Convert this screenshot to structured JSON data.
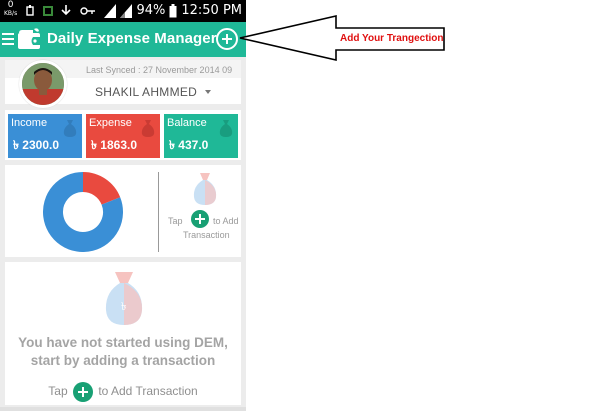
{
  "status_bar": {
    "kb_value": "0",
    "kb_unit": "KB/s",
    "battery": "94%",
    "time": "12:50 PM"
  },
  "app_bar": {
    "title": "Daily Expense Manager",
    "menu_icon": "hamburger-icon",
    "logo_icon": "wallet-logo",
    "add_icon": "plus-circle-icon"
  },
  "sync": {
    "text": "Last Synced : 27 November 2014 09"
  },
  "profile": {
    "name": "SHAKIL AHMMED"
  },
  "summary": {
    "income": {
      "label": "Income",
      "value": "৳ 2300.0",
      "color": "#3a8fd6"
    },
    "expense": {
      "label": "Expense",
      "value": "৳ 1863.0",
      "color": "#e94a3f"
    },
    "balance": {
      "label": "Balance",
      "value": "৳ 437.0",
      "color": "#1fb897"
    }
  },
  "chart_data": {
    "type": "pie",
    "style": "donut",
    "labels": [
      "Balance",
      "Expense"
    ],
    "values": [
      437.0,
      1863.0
    ],
    "colors": [
      "#e94a3f",
      "#3a8fd6"
    ]
  },
  "chart_side": {
    "tap": "Tap",
    "to_add": "to Add",
    "transaction": "Transaction"
  },
  "empty_state": {
    "line1": "You have not started using DEM,",
    "line2": "start by adding a transaction",
    "tap": "Tap",
    "to_add": "to Add Transaction"
  },
  "annotation": {
    "text": "Add Your Trangection"
  }
}
